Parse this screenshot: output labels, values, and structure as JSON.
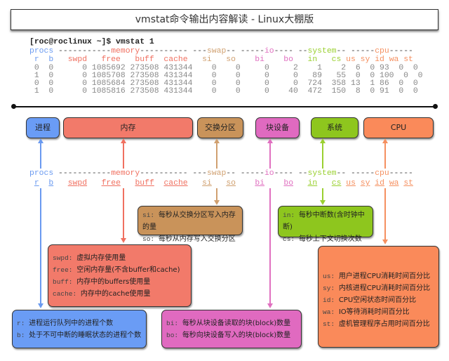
{
  "title": "vmstat命令输出内容解读 - Linux大棚版",
  "colors": {
    "procs": "#6a9af0",
    "memory": "#f07060",
    "swap": "#d0a070",
    "io": "#e070c0",
    "system": "#9ad030",
    "cpu": "#f59060",
    "dash": "#444"
  },
  "terminal": {
    "command": "[roc@roclinux ~]$ vmstat 1",
    "group_header": [
      {
        "t": "procs",
        "c": "procs"
      },
      {
        "t": " -----------",
        "c": "dash"
      },
      {
        "t": "memory",
        "c": "memory"
      },
      {
        "t": "---------- ---",
        "c": "dash"
      },
      {
        "t": "swap",
        "c": "swap"
      },
      {
        "t": "-- -----",
        "c": "dash"
      },
      {
        "t": "io",
        "c": "io"
      },
      {
        "t": "---- --",
        "c": "dash"
      },
      {
        "t": "system",
        "c": "system"
      },
      {
        "t": "-- -----",
        "c": "dash"
      },
      {
        "t": "cpu",
        "c": "cpu"
      },
      {
        "t": "-----",
        "c": "dash"
      }
    ],
    "column_header": [
      {
        "t": " r  b",
        "c": "procs"
      },
      {
        "t": "   swpd   free   buff  cache",
        "c": "memory"
      },
      {
        "t": "   si   so",
        "c": "swap"
      },
      {
        "t": "    bi    bo",
        "c": "io"
      },
      {
        "t": "   in   cs",
        "c": "system"
      },
      {
        "t": " us sy id wa st",
        "c": "cpu"
      }
    ],
    "rows": [
      " 0  0      0 1085692 273508 431344    0    0     0     2    1    2  6  0 93  0  0",
      " 1  0      0 1085708 273508 431344    0    0     0     0   89   55  0  0 100  0  0",
      " 0  0      0 1085684 273508 431344    0    0     0     0  724  358 13  1 86  0  0",
      " 1  0      0 1085816 273508 431344    0    0     0    40  472  150  8  0 91  0  0"
    ]
  },
  "categories": {
    "procs": "进程",
    "memory": "内存",
    "swap": "交换分区",
    "io": "块设备",
    "system": "系统",
    "cpu": "CPU"
  },
  "descriptions": {
    "swap": [
      {
        "k": "si:",
        "v": "每秒从交换分区写入内存的量"
      },
      {
        "k": "so:",
        "v": "每秒从内存写入交换分区的量"
      }
    ],
    "system": [
      {
        "k": "in:",
        "v": "每秒中断数(含时钟中断)"
      },
      {
        "k": "cs:",
        "v": "每秒上下文切换次数"
      }
    ],
    "memory": [
      {
        "k": "swpd:",
        "v": "虚拟内存使用量"
      },
      {
        "k": "free:",
        "v": "空闲内存量(不含buffer和cache)"
      },
      {
        "k": "buff:",
        "v": "内存中的buffers使用量"
      },
      {
        "k": "cache:",
        "v": "内存中的cache使用量"
      }
    ],
    "cpu": [
      {
        "k": "us:",
        "v": "用户进程CPU消耗时间百分比"
      },
      {
        "k": "sy:",
        "v": "内核进程CPU消耗时间百分比"
      },
      {
        "k": "id:",
        "v": "CPU空闲状态时间百分比"
      },
      {
        "k": "wa:",
        "v": "IO等待消耗时间百分比"
      },
      {
        "k": "st:",
        "v": "虚机管理程序占用时间百分比"
      }
    ],
    "procs": [
      {
        "k": "r:",
        "v": "进程运行队列中的进程个数"
      },
      {
        "k": "b:",
        "v": "处于不可中断的睡眠状态的进程个数"
      }
    ],
    "io": [
      {
        "k": "bi:",
        "v": "每秒从块设备读取的块(block)数量"
      },
      {
        "k": "bo:",
        "v": "每秒向块设备写入的块(block)数量"
      }
    ]
  }
}
